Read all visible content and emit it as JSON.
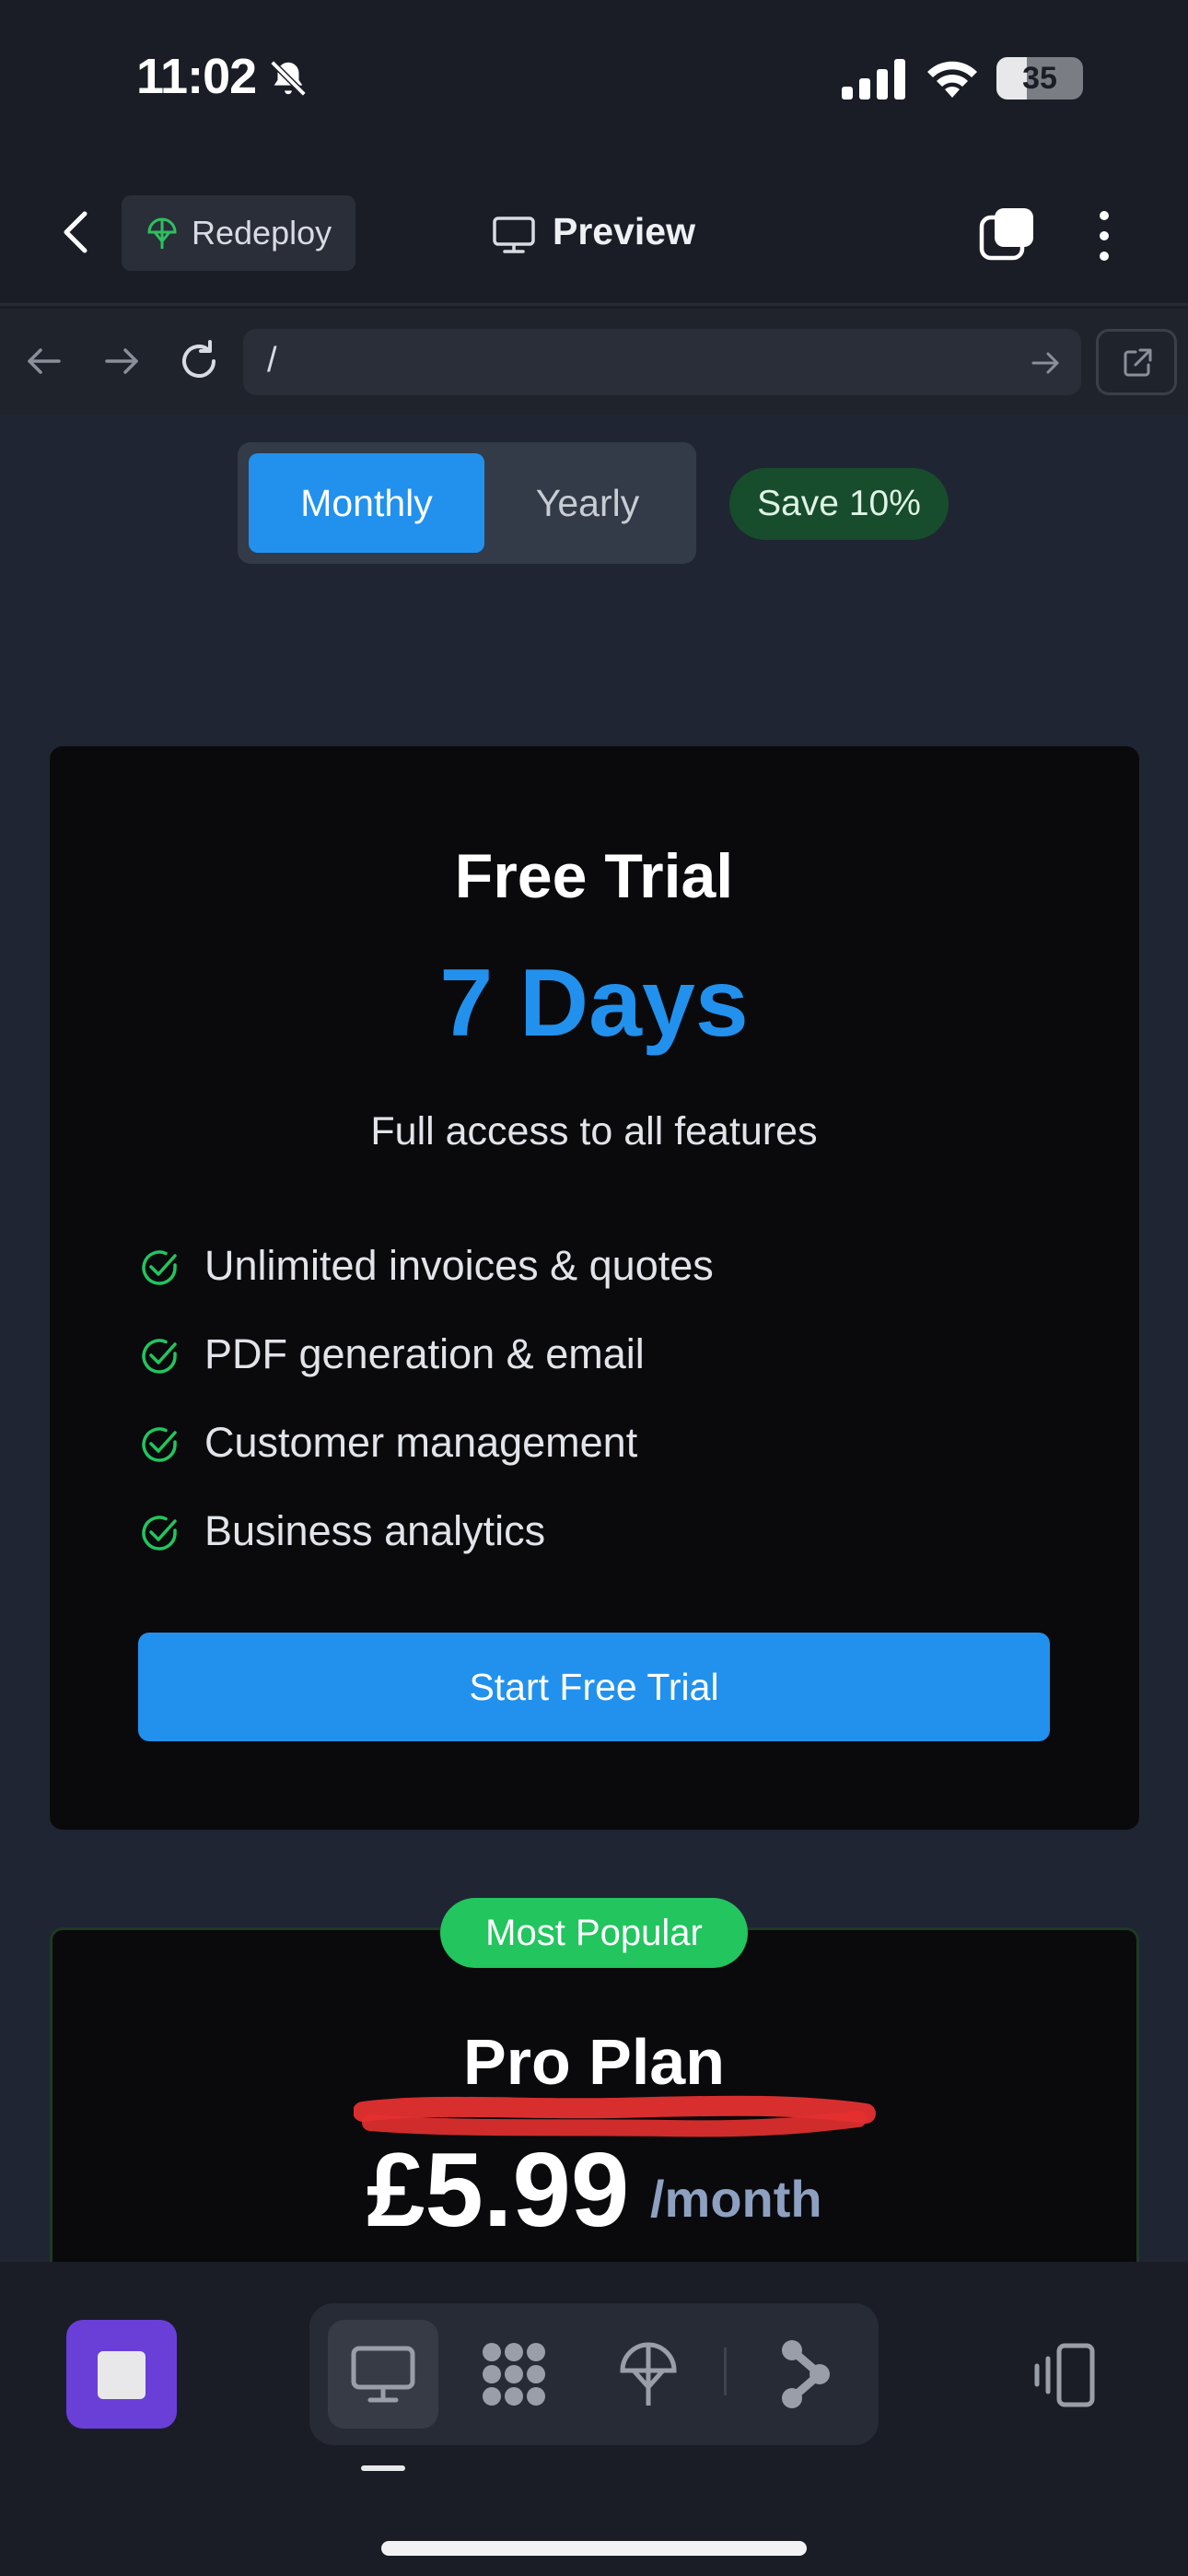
{
  "status_bar": {
    "time": "11:02",
    "battery": "35"
  },
  "header": {
    "redeploy_label": "Redeploy",
    "preview_label": "Preview"
  },
  "browser": {
    "url": "/"
  },
  "pricing": {
    "toggle": {
      "monthly": "Monthly",
      "yearly": "Yearly",
      "selected": "Monthly"
    },
    "save_badge": "Save 10%",
    "trial": {
      "title": "Free Trial",
      "duration": "7 Days",
      "subtitle": "Full access to all features",
      "features": [
        "Unlimited invoices & quotes",
        "PDF generation & email",
        "Customer management",
        "Business analytics"
      ],
      "cta": "Start Free Trial"
    },
    "pro": {
      "badge": "Most Popular",
      "title": "Pro Plan",
      "price": "£5.99",
      "period": "/month"
    }
  },
  "icons": {
    "bell": "bell-slash-icon",
    "redeploy": "tree-icon",
    "preview": "monitor-icon",
    "mode_preview": "monitor-icon",
    "mode_apps": "grid-icon",
    "mode_deploy": "tree-icon",
    "mode_flow": "share-icon",
    "device": "device-rotate-icon"
  },
  "colors": {
    "accent": "#2291ed",
    "success": "#22c55e",
    "stop": "#6a3fd8",
    "annotation": "#e53030"
  }
}
